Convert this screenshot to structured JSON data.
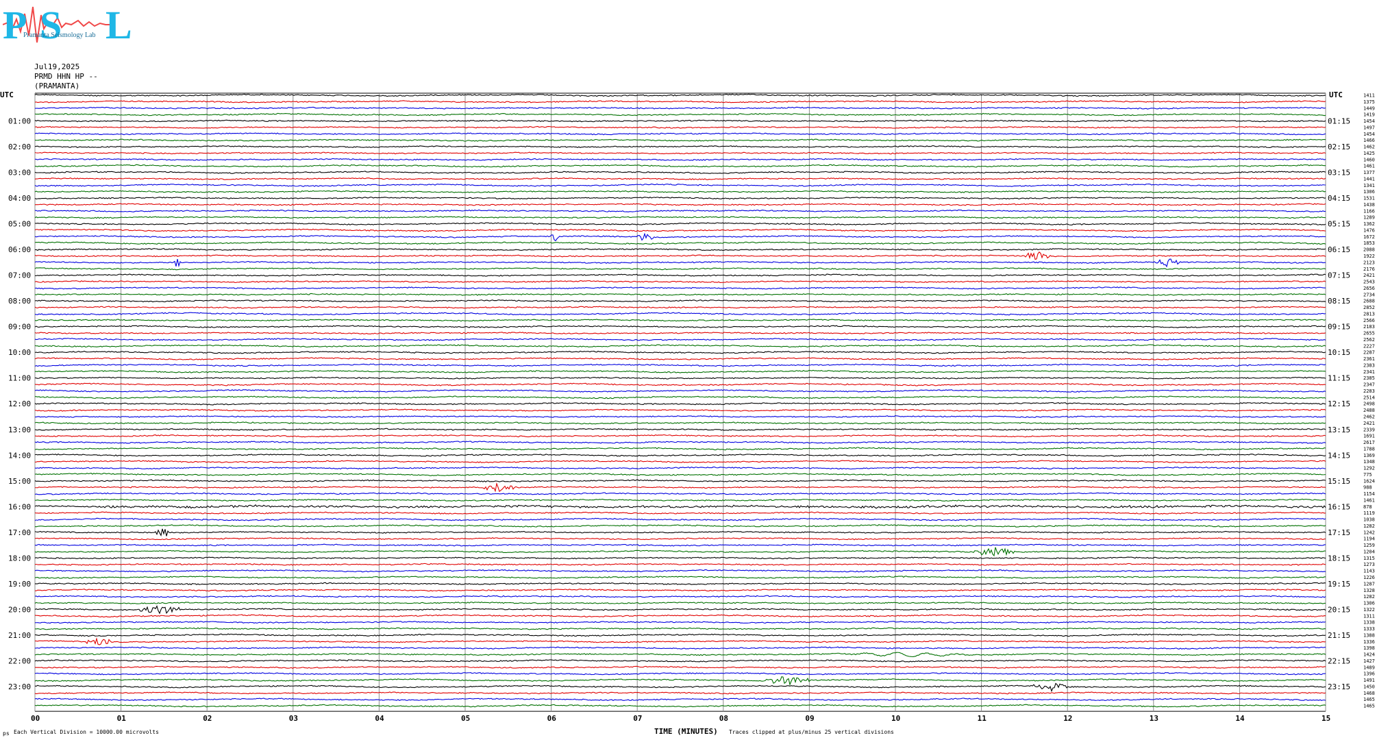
{
  "logo": {
    "big_p": "P",
    "big_s": "S",
    "big_l": "L",
    "small_text": "Pramanta  Seismology  Lab"
  },
  "header": {
    "date": "Jul19,2025",
    "station": "PRMD HHN HP --",
    "site": "(PRAMANTA)"
  },
  "footer": {
    "x_axis_label": "TIME (MINUTES)",
    "vertical_division": "Each Vertical Division = 10000.00 microvolts",
    "clip_note": "Traces clipped at plus/minus 25 vertical divisions",
    "corner_mark": "ps"
  },
  "colors": {
    "black": "#000000",
    "red": "#e00000",
    "blue": "#0000e0",
    "green": "#007000",
    "grid": "#8c8c8c"
  },
  "chart_data": {
    "type": "line",
    "subtype": "helicorder",
    "x_axis": {
      "label": "TIME (MINUTES)",
      "range": [
        0,
        15
      ],
      "ticks": [
        "00",
        "01",
        "02",
        "03",
        "04",
        "05",
        "06",
        "07",
        "08",
        "09",
        "10",
        "11",
        "12",
        "13",
        "14",
        "15"
      ]
    },
    "left_label_header": "UTC",
    "right_label_header": "UTC",
    "left_labels": [
      "01:00",
      "02:00",
      "03:00",
      "04:00",
      "05:00",
      "06:00",
      "07:00",
      "08:00",
      "09:00",
      "10:00",
      "11:00",
      "12:00",
      "13:00",
      "14:00",
      "15:00",
      "16:00",
      "17:00",
      "18:00",
      "19:00",
      "20:00",
      "21:00",
      "22:00",
      "23:00"
    ],
    "right_labels": [
      "01:15",
      "02:15",
      "03:15",
      "04:15",
      "05:15",
      "06:15",
      "07:15",
      "08:15",
      "09:15",
      "10:15",
      "11:15",
      "12:15",
      "13:15",
      "14:15",
      "15:15",
      "16:15",
      "17:15",
      "18:15",
      "19:15",
      "20:15",
      "21:15",
      "22:15",
      "23:15"
    ],
    "trace_minutes": 15,
    "trace_colors_cycle": [
      "black",
      "red",
      "blue",
      "green"
    ],
    "trace_count": 96,
    "right_values": [
      "1411",
      "1375",
      "1449",
      "1419",
      "1454",
      "1497",
      "1454",
      "1466",
      "1462",
      "1425",
      "1460",
      "1461",
      "1377",
      "1441",
      "1341",
      "1306",
      "1531",
      "1438",
      "1166",
      "1289",
      "1362",
      "1476",
      "1672",
      "1853",
      "2088",
      "1922",
      "2123",
      "2176",
      "2421",
      "2543",
      "2656",
      "2734",
      "2688",
      "2852",
      "2813",
      "2566",
      "2183",
      "2655",
      "2562",
      "2227",
      "2287",
      "2361",
      "2383",
      "2341",
      "2385",
      "2347",
      "2283",
      "2514",
      "2498",
      "2488",
      "2462",
      "2421",
      "2339",
      "1691",
      "2617",
      "1788",
      "1369",
      "1348",
      "1292",
      "775",
      "1624",
      "988",
      "1154",
      "1461",
      "878",
      "1119",
      "1038",
      "1282",
      "1242",
      "1194",
      "1259",
      "1204",
      "1315",
      "1273",
      "1143",
      "1226",
      "1287",
      "1328",
      "1282",
      "1306",
      "1322",
      "1311",
      "1338",
      "1333",
      "1388",
      "1336",
      "1398",
      "1424",
      "1427",
      "1489",
      "1396",
      "1491",
      "1450",
      "1468",
      "1465",
      "1465"
    ],
    "events": [
      {
        "trace": 22,
        "color": "blue",
        "minutes": [
          7.0,
          7.2
        ],
        "note": "burst"
      },
      {
        "trace": 22,
        "color": "blue",
        "minutes": [
          6.0,
          6.1
        ],
        "note": "burst"
      },
      {
        "trace": 25,
        "color": "red",
        "minutes": [
          11.5,
          11.8
        ],
        "note": "burst"
      },
      {
        "trace": 26,
        "color": "blue",
        "minutes": [
          13.0,
          13.3
        ],
        "note": "burst"
      },
      {
        "trace": 26,
        "color": "blue",
        "minutes": [
          1.6,
          1.7
        ],
        "note": "burst"
      },
      {
        "trace": 61,
        "color": "red",
        "minutes": [
          5.2,
          5.6
        ],
        "note": "burst"
      },
      {
        "trace": 64,
        "color": "black",
        "minutes": [
          0.8,
          15.0
        ],
        "note": "noisy"
      },
      {
        "trace": 68,
        "color": "black",
        "minutes": [
          1.4,
          1.6
        ],
        "note": "burst"
      },
      {
        "trace": 71,
        "color": "green",
        "minutes": [
          10.9,
          11.4
        ],
        "note": "burst"
      },
      {
        "trace": 80,
        "color": "black",
        "minutes": [
          1.2,
          1.7
        ],
        "note": "burst"
      },
      {
        "trace": 85,
        "color": "red",
        "minutes": [
          0.6,
          0.9
        ],
        "note": "burst"
      },
      {
        "trace": 87,
        "color": "green",
        "minutes": [
          9.2,
          11.0
        ],
        "note": "wavy"
      },
      {
        "trace": 91,
        "color": "green",
        "minutes": [
          8.5,
          9.0
        ],
        "note": "burst"
      },
      {
        "trace": 92,
        "color": "black",
        "minutes": [
          11.6,
          12.0
        ],
        "note": "burst"
      }
    ]
  }
}
